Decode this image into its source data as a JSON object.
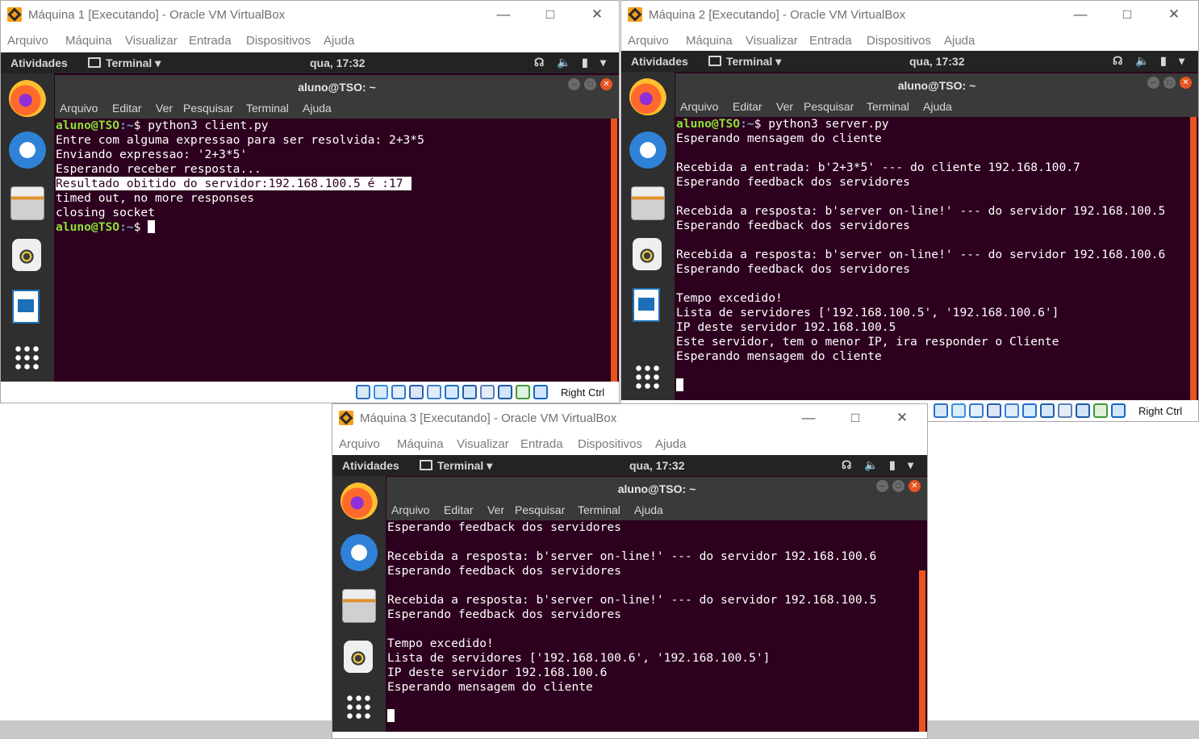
{
  "windows": [
    {
      "title": "Máquina 1 [Executando] - Oracle VM VirtualBox",
      "menu": [
        "Arquivo",
        "Máquina",
        "Visualizar",
        "Entrada",
        "Dispositivos",
        "Ajuda"
      ],
      "gnome": {
        "activities": "Atividades",
        "app": "Terminal",
        "clock": "qua, 17:32"
      },
      "terminal": {
        "title": "aluno@TSO: ~",
        "menu": [
          "Arquivo",
          "Editar",
          "Ver",
          "Pesquisar",
          "Terminal",
          "Ajuda"
        ],
        "lines": [
          {
            "user": "aluno@TSO",
            "path": ":~",
            "text": "$ python3 client.py"
          },
          {
            "text": "Entre com alguma expressao para ser resolvida: 2+3*5"
          },
          {
            "text": "Enviando expressao: '2+3*5'"
          },
          {
            "text": "Esperando receber resposta..."
          },
          {
            "text": "Resultado obitido do servidor:192.168.100.5 é :17",
            "highlight": true
          },
          {
            "text": "timed out, no more responses"
          },
          {
            "text": "closing socket"
          },
          {
            "user": "aluno@TSO",
            "path": ":~",
            "text": "$ ",
            "cursor": true
          }
        ]
      },
      "status": {
        "host_key": "Right Ctrl"
      }
    },
    {
      "title": "Máquina 2 [Executando] - Oracle VM VirtualBox",
      "menu": [
        "Arquivo",
        "Máquina",
        "Visualizar",
        "Entrada",
        "Dispositivos",
        "Ajuda"
      ],
      "gnome": {
        "activities": "Atividades",
        "app": "Terminal",
        "clock": "qua, 17:32"
      },
      "terminal": {
        "title": "aluno@TSO: ~",
        "menu": [
          "Arquivo",
          "Editar",
          "Ver",
          "Pesquisar",
          "Terminal",
          "Ajuda"
        ],
        "lines": [
          {
            "user": "aluno@TSO",
            "path": ":~",
            "text": "$ python3 server.py"
          },
          {
            "text": "Esperando mensagem do cliente"
          },
          {
            "text": ""
          },
          {
            "text": "Recebida a entrada: b'2+3*5' --- do cliente 192.168.100.7"
          },
          {
            "text": "Esperando feedback dos servidores"
          },
          {
            "text": ""
          },
          {
            "text": "Recebida a resposta: b'server on-line!' --- do servidor 192.168.100.5"
          },
          {
            "text": "Esperando feedback dos servidores"
          },
          {
            "text": ""
          },
          {
            "text": "Recebida a resposta: b'server on-line!' --- do servidor 192.168.100.6"
          },
          {
            "text": "Esperando feedback dos servidores"
          },
          {
            "text": ""
          },
          {
            "text": "Tempo excedido!"
          },
          {
            "text": "Lista de servidores ['192.168.100.5', '192.168.100.6']"
          },
          {
            "text": "IP deste servidor 192.168.100.5"
          },
          {
            "text": "Este servidor, tem o menor IP, ira responder o Cliente"
          },
          {
            "text": "Esperando mensagem do cliente"
          },
          {
            "text": ""
          },
          {
            "text": "",
            "cursor": true
          }
        ]
      },
      "status": {
        "host_key": "Right Ctrl"
      }
    },
    {
      "title": "Máquina 3 [Executando] - Oracle VM VirtualBox",
      "menu": [
        "Arquivo",
        "Máquina",
        "Visualizar",
        "Entrada",
        "Dispositivos",
        "Ajuda"
      ],
      "gnome": {
        "activities": "Atividades",
        "app": "Terminal",
        "clock": "qua, 17:32"
      },
      "terminal": {
        "title": "aluno@TSO: ~",
        "menu": [
          "Arquivo",
          "Editar",
          "Ver",
          "Pesquisar",
          "Terminal",
          "Ajuda"
        ],
        "lines": [
          {
            "text": "Esperando feedback dos servidores"
          },
          {
            "text": ""
          },
          {
            "text": "Recebida a resposta: b'server on-line!' --- do servidor 192.168.100.6"
          },
          {
            "text": "Esperando feedback dos servidores"
          },
          {
            "text": ""
          },
          {
            "text": "Recebida a resposta: b'server on-line!' --- do servidor 192.168.100.5"
          },
          {
            "text": "Esperando feedback dos servidores"
          },
          {
            "text": ""
          },
          {
            "text": "Tempo excedido!"
          },
          {
            "text": "Lista de servidores ['192.168.100.6', '192.168.100.5']"
          },
          {
            "text": "IP deste servidor 192.168.100.6"
          },
          {
            "text": "Esperando mensagem do cliente"
          },
          {
            "text": ""
          },
          {
            "text": "",
            "cursor": true
          }
        ]
      },
      "status": {
        "host_key": ""
      }
    }
  ],
  "colors": {
    "terminal_bg": "#2c001e",
    "prompt_user": "#8ae234",
    "prompt_path": "#729fcf",
    "accent": "#e95420"
  },
  "icons": {
    "dock": [
      "firefox-icon",
      "thunderbird-icon",
      "files-icon",
      "rhythmbox-icon",
      "libreoffice-writer-icon",
      "show-applications-icon"
    ],
    "tray": [
      "network-icon",
      "volume-icon",
      "battery-icon",
      "chevron-down-icon"
    ],
    "window_controls": [
      "minimize-icon",
      "maximize-icon",
      "close-icon"
    ]
  }
}
